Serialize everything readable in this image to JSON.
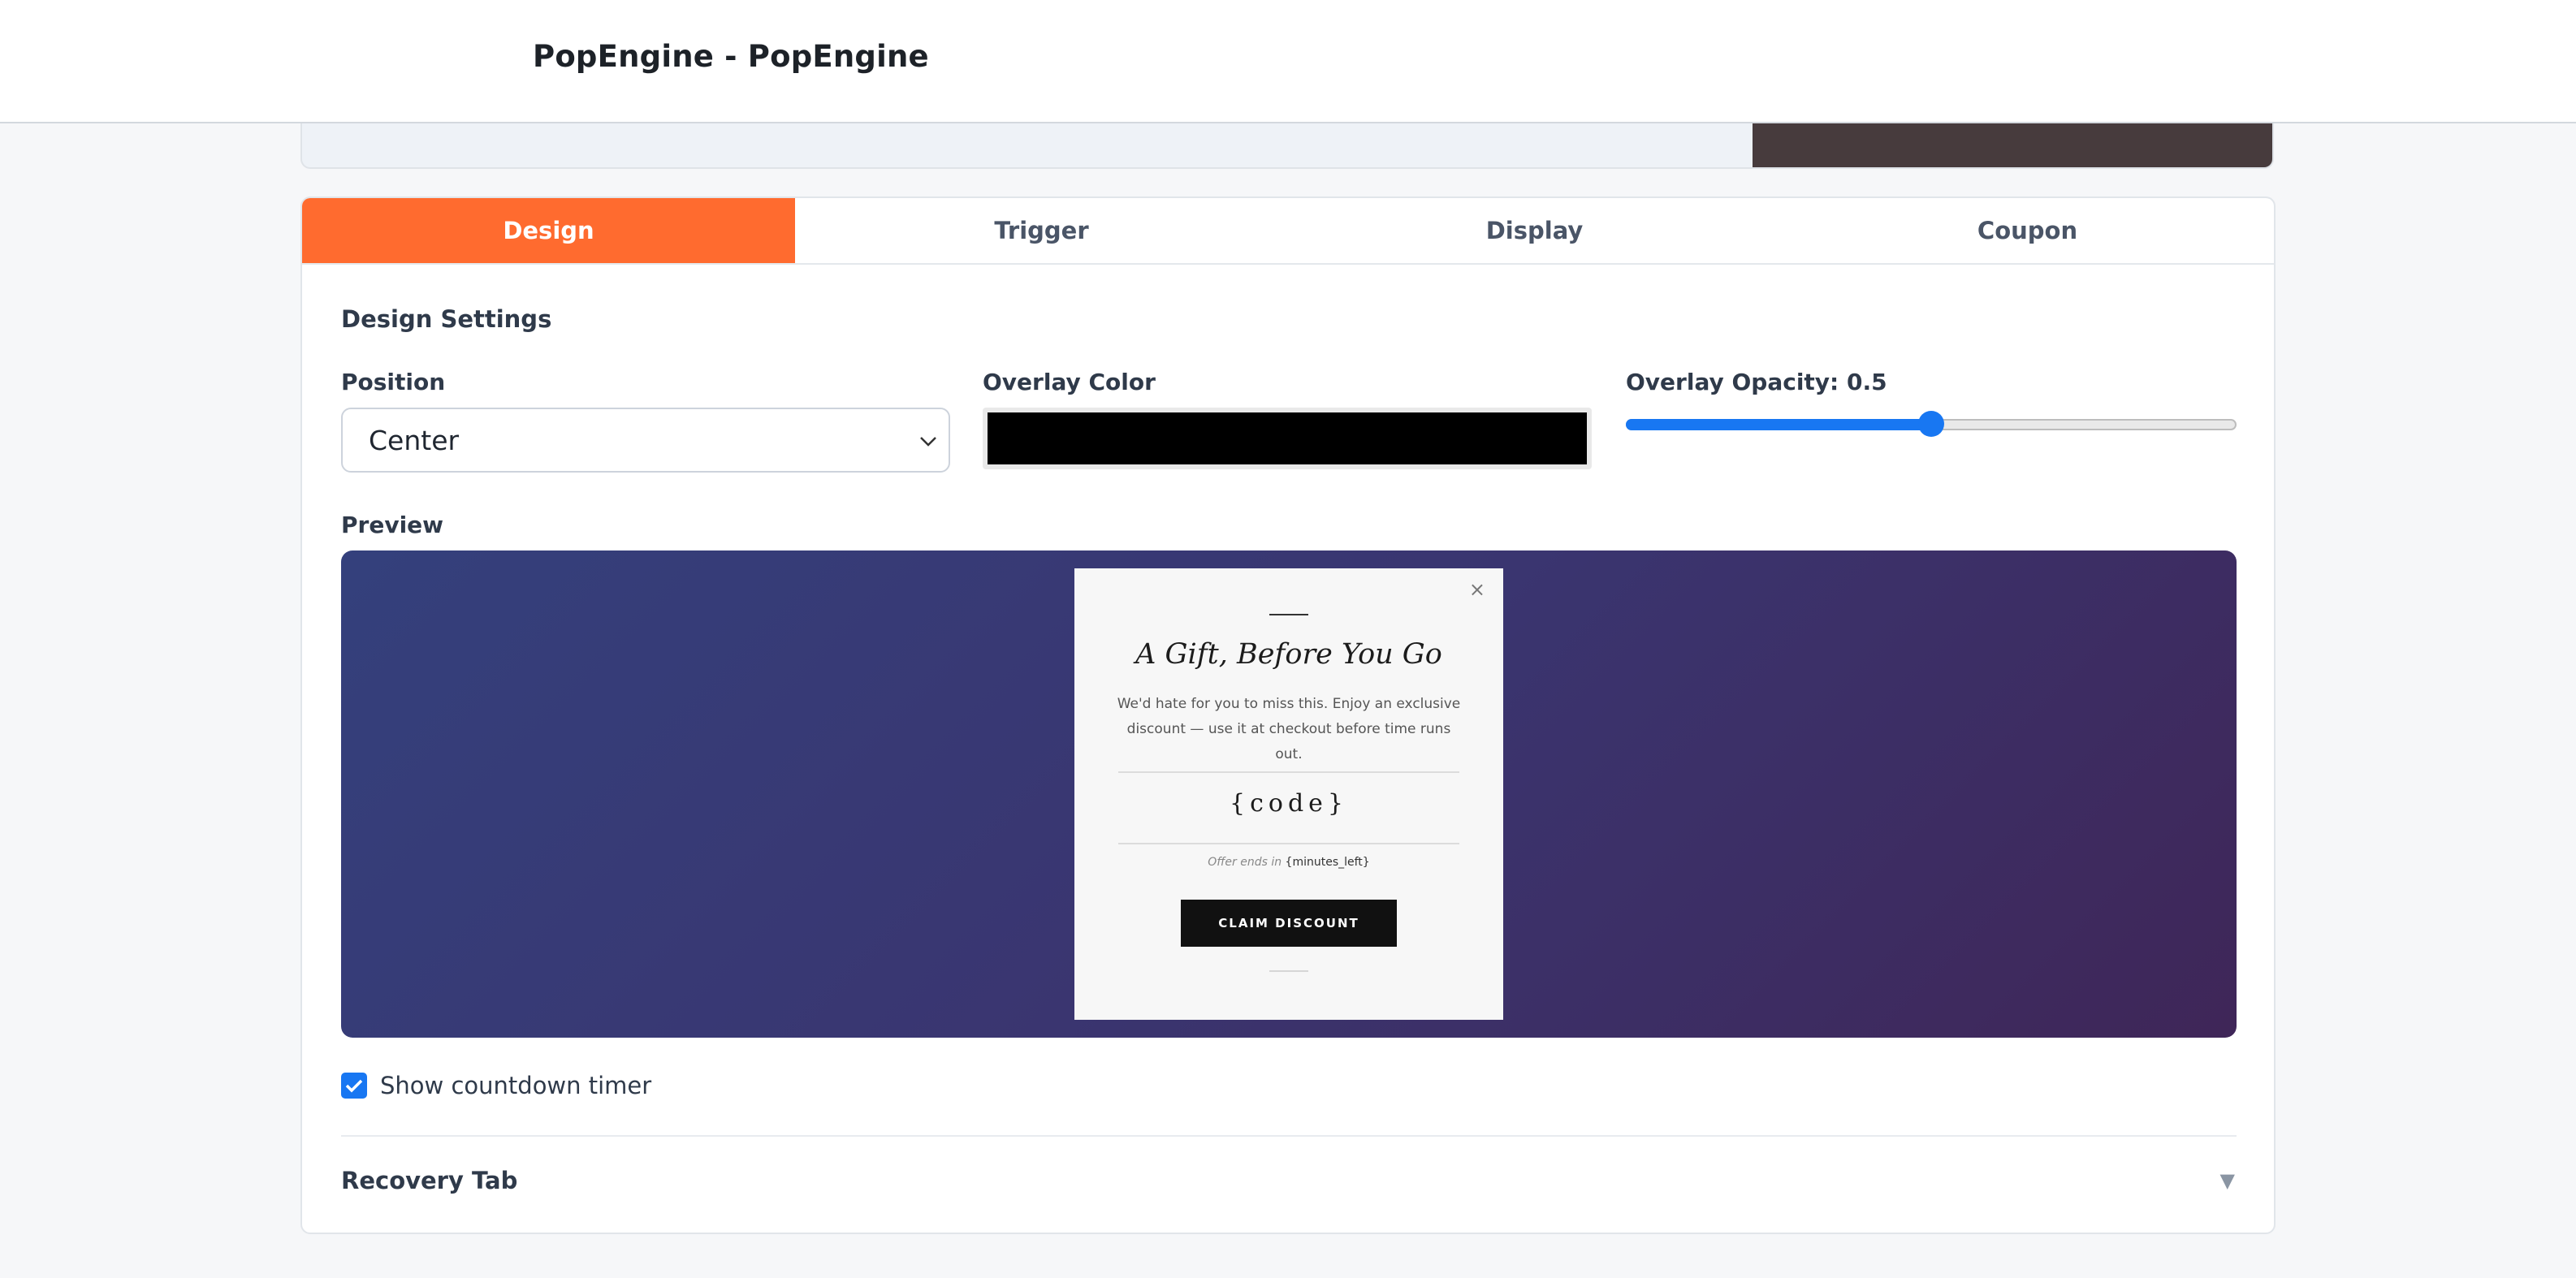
{
  "app": {
    "title": "PopEngine - PopEngine"
  },
  "tabs": [
    {
      "label": "Design",
      "active": true
    },
    {
      "label": "Trigger",
      "active": false
    },
    {
      "label": "Display",
      "active": false
    },
    {
      "label": "Coupon",
      "active": false
    }
  ],
  "design": {
    "section_title": "Design Settings",
    "position": {
      "label": "Position",
      "value": "Center"
    },
    "overlay_color": {
      "label": "Overlay Color",
      "value": "#000000"
    },
    "overlay_opacity": {
      "label": "Overlay Opacity: 0.5",
      "value": 0.5
    },
    "preview_label": "Preview"
  },
  "popup": {
    "heading": "A Gift, Before You Go",
    "body": "We'd hate for you to miss this. Enjoy an exclusive discount — use it at checkout before time runs out.",
    "code": "{code}",
    "timer_prefix": "Offer ends in",
    "timer_value": "{minutes_left}",
    "button": "CLAIM DISCOUNT",
    "close": "×"
  },
  "countdown": {
    "label": "Show countdown timer",
    "checked": true
  },
  "recovery": {
    "label": "Recovery Tab",
    "arrow": "▼"
  },
  "colors": {
    "accent": "#ff6b2f",
    "checkbox": "#1877f2",
    "preview_gradient_start": "#34407c",
    "preview_gradient_end": "#3f2658"
  }
}
